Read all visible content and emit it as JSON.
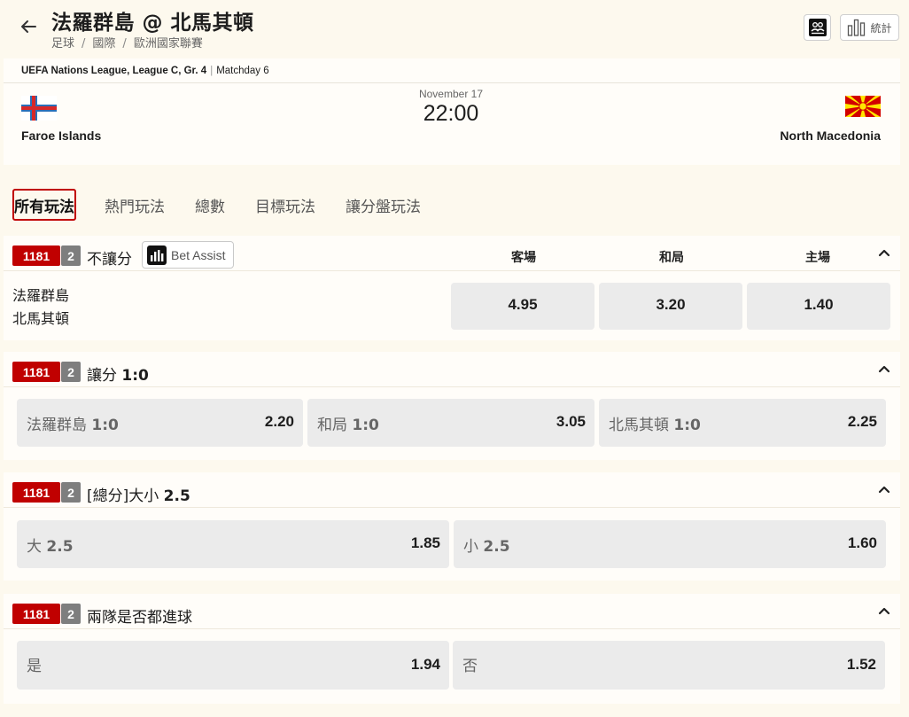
{
  "header": {
    "title": "法羅群島 @ 北馬其頓",
    "breadcrumb": [
      "足球",
      "國際",
      "歐洲國家聯賽"
    ],
    "stats_label": "統計",
    "back_icon": "arrow-left-icon",
    "lineup_icon": "lineup-icon",
    "stats_icon": "bar-chart-icon"
  },
  "match": {
    "league": "UEFA Nations League, League C, Gr. 4",
    "matchday": "Matchday 6",
    "date": "November 17",
    "time": "22:00",
    "home_team": "Faroe Islands",
    "away_team": "North Macedonia"
  },
  "tabs": [
    {
      "label": "所有玩法",
      "active": true
    },
    {
      "label": "熱門玩法",
      "active": false
    },
    {
      "label": "總數",
      "active": false
    },
    {
      "label": "目標玩法",
      "active": false
    },
    {
      "label": "讓分盤玩法",
      "active": false
    }
  ],
  "markets": [
    {
      "code": "1181",
      "num": "2",
      "title": "不讓分",
      "bet_assist": "Bet Assist",
      "columns": [
        "客場",
        "和局",
        "主場"
      ],
      "teams": [
        "法羅群島",
        "北馬其頓"
      ],
      "odds": [
        "4.95",
        "3.20",
        "1.40"
      ]
    },
    {
      "code": "1181",
      "num": "2",
      "title": "讓分",
      "title_bold": "1:0",
      "options": [
        {
          "label": "法羅群島",
          "line": "1:0",
          "odds": "2.20"
        },
        {
          "label": "和局",
          "line": "1:0",
          "odds": "3.05"
        },
        {
          "label": "北馬其頓",
          "line": "1:0",
          "odds": "2.25"
        }
      ]
    },
    {
      "code": "1181",
      "num": "2",
      "title": "[總分]大小",
      "title_bold": "2.5",
      "options": [
        {
          "label": "大",
          "line": "2.5",
          "odds": "1.85"
        },
        {
          "label": "小",
          "line": "2.5",
          "odds": "1.60"
        }
      ]
    },
    {
      "code": "1181",
      "num": "2",
      "title": "兩隊是否都進球",
      "options": [
        {
          "label": "是",
          "odds": "1.94"
        },
        {
          "label": "否",
          "odds": "1.52"
        }
      ]
    }
  ],
  "colors": {
    "accent": "#c00000",
    "background": "#fdf9ee",
    "odds_button": "#ebebeb",
    "num_badge": "#7e7e7e"
  }
}
